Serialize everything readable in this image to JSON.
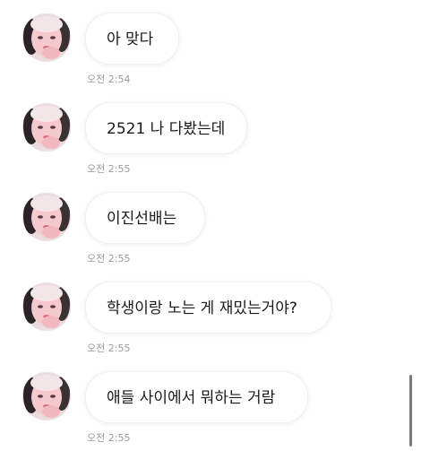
{
  "messages": [
    {
      "text": "아 맞다",
      "time": "오전 2:54"
    },
    {
      "text": "2521 나 다봤는데",
      "time": "오전 2:55"
    },
    {
      "text": "이진선배는",
      "time": "오전 2:55"
    },
    {
      "text": "학생이랑 노는 게 재밌는거야?",
      "time": "오전 2:55"
    },
    {
      "text": "애들 사이에서 뭐하는 거람",
      "time": "오전 2:55"
    }
  ],
  "avatar_icon": "profile-photo-icon"
}
